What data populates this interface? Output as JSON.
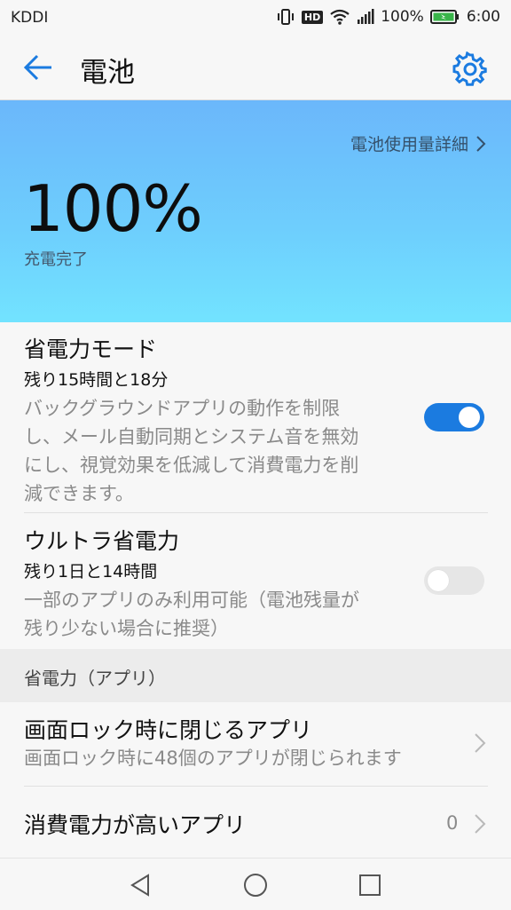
{
  "status": {
    "carrier": "KDDI",
    "hd_badge": "HD",
    "battery_percent": "100%",
    "time": "6:00"
  },
  "appbar": {
    "title": "電池"
  },
  "hero": {
    "detail_link": "電池使用量詳細",
    "percent": "100%",
    "charge_state": "充電完了"
  },
  "power_saving": {
    "title": "省電力モード",
    "remaining": "残り15時間と18分",
    "desc_lines": [
      "バックグラウンドアプリの動作を制限",
      "し、メール自動同期とシステム音を無効",
      "にし、視覚効果を低減して消費電力を削",
      "減できます。"
    ],
    "enabled": true
  },
  "ultra": {
    "title": "ウルトラ省電力",
    "remaining": "残り1日と14時間",
    "desc_lines": [
      "一部のアプリのみ利用可能（電池残量が",
      "残り少ない場合に推奨）"
    ],
    "enabled": false
  },
  "section_header": "省電力（アプリ）",
  "lock_apps": {
    "title": "画面ロック時に閉じるアプリ",
    "subtitle": "画面ロック時に48個のアプリが閉じられます"
  },
  "high_power": {
    "title": "消費電力が高いアプリ",
    "count": "0"
  },
  "colors": {
    "accent": "#1b7be0",
    "hero_top": "#6bb7fb",
    "hero_bottom": "#72e3ff"
  }
}
